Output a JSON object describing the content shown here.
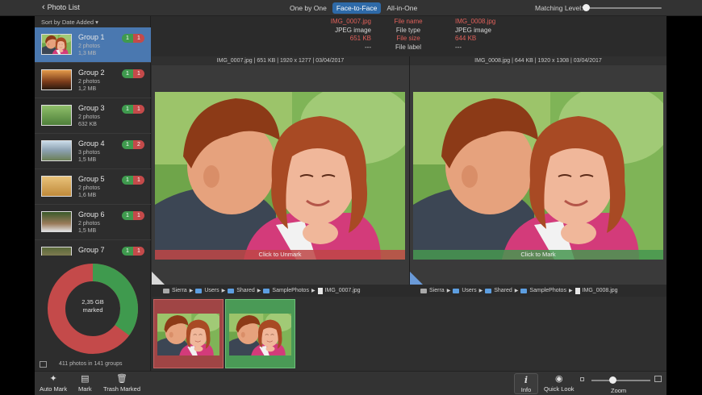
{
  "topbar": {
    "back_label": "Photo List",
    "modes": [
      "One by One",
      "Face-to-Face",
      "All-in-One"
    ],
    "active_mode": "Face-to-Face",
    "matching_label": "Matching Level:"
  },
  "sidebar": {
    "sort_label": "Sort by Date Added",
    "groups": [
      {
        "name": "Group 1",
        "photos": "2 photos",
        "size": "1,3 MB",
        "green": "1",
        "red": "1"
      },
      {
        "name": "Group 2",
        "photos": "2 photos",
        "size": "1,2 MB",
        "green": "1",
        "red": "1"
      },
      {
        "name": "Group 3",
        "photos": "2 photos",
        "size": "632 KB",
        "green": "1",
        "red": "1"
      },
      {
        "name": "Group 4",
        "photos": "3 photos",
        "size": "1,5 MB",
        "green": "1",
        "red": "2"
      },
      {
        "name": "Group 5",
        "photos": "2 photos",
        "size": "1,6 MB",
        "green": "1",
        "red": "1"
      },
      {
        "name": "Group 6",
        "photos": "2 photos",
        "size": "1,5 MB",
        "green": "1",
        "red": "1"
      },
      {
        "name": "Group 7",
        "photos": "",
        "size": "",
        "green": "1",
        "red": "1"
      }
    ],
    "donut": {
      "value": "2,35 GB",
      "label": "marked",
      "marked_fraction": 0.65
    },
    "footer": "411 photos in 141 groups"
  },
  "info": {
    "left": {
      "name": "IMG_0007.jpg",
      "type": "JPEG image",
      "size": "651 KB",
      "label": "---"
    },
    "fields": {
      "name": "File name",
      "type": "File type",
      "size": "File size",
      "label": "File label"
    },
    "right": {
      "name": "IMG_0008.jpg",
      "type": "JPEG image",
      "size": "644 KB",
      "label": "---"
    }
  },
  "panes": {
    "left": {
      "header": "IMG_0007.jpg | 651 KB | 1920 x 1277 | 03/04/2017",
      "bar": "Click to Unmark"
    },
    "right": {
      "header": "IMG_0008.jpg | 644 KB | 1920 x 1308 | 03/04/2017",
      "bar": "Click to Mark"
    }
  },
  "paths": {
    "left": [
      "Sierra",
      "Users",
      "Shared",
      "SamplePhotos",
      "IMG_0007.jpg"
    ],
    "right": [
      "Sierra",
      "Users",
      "Shared",
      "SamplePhotos",
      "IMG_0008.jpg"
    ]
  },
  "toolbar": {
    "auto_mark": "Auto Mark",
    "mark": "Mark",
    "trash_marked": "Trash Marked",
    "info": "Info",
    "quick_look": "Quick Look",
    "zoom": "Zoom"
  },
  "colors": {
    "accent": "#2e6aa8",
    "marked": "#c44a4a",
    "unmarked": "#3f9a4e"
  }
}
